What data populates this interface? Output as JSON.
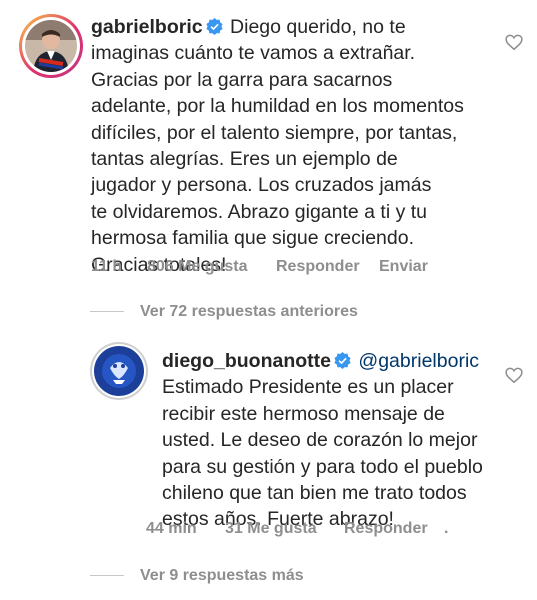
{
  "comment1": {
    "username": "gabrielboric",
    "text_lines": [
      "Diego querido, no te",
      "imaginas cuánto te vamos a extrañar.",
      "Gracias por la garra para sacarnos",
      "adelante, por la humildad en los momentos",
      "difíciles, por el talento siempre, por tantas,",
      "tantas alegrías. Eres un ejemplo de",
      "jugador y persona. Los cruzados jamás",
      "te olvidaremos. Abrazo gigante a ti y tu",
      "hermosa familia que sigue creciendo.",
      "Gracias totales!"
    ],
    "time": "11 h",
    "likes": "806 Me gusta",
    "reply": "Responder",
    "send": "Enviar"
  },
  "view_previous": "Ver 72 respuestas anteriores",
  "comment2": {
    "username": "diego_buonanotte",
    "mention": "@gabrielboric",
    "text_lines": [
      "Estimado Presidente es un placer",
      "recibir este hermoso mensaje de",
      "usted. Le deseo de corazón lo mejor",
      "para su gestión y para todo el pueblo",
      "chileno que tan bien me trato todos",
      "estos años. Fuerte abrazo!"
    ],
    "time": "44 min",
    "likes": "31 Me gusta",
    "reply": "Responder",
    "more": "."
  },
  "view_more": "Ver 9 respuestas más",
  "colors": {
    "text": "#262626",
    "meta": "#8e8e8e",
    "verified": "#3897f0",
    "mention": "#00376b"
  }
}
